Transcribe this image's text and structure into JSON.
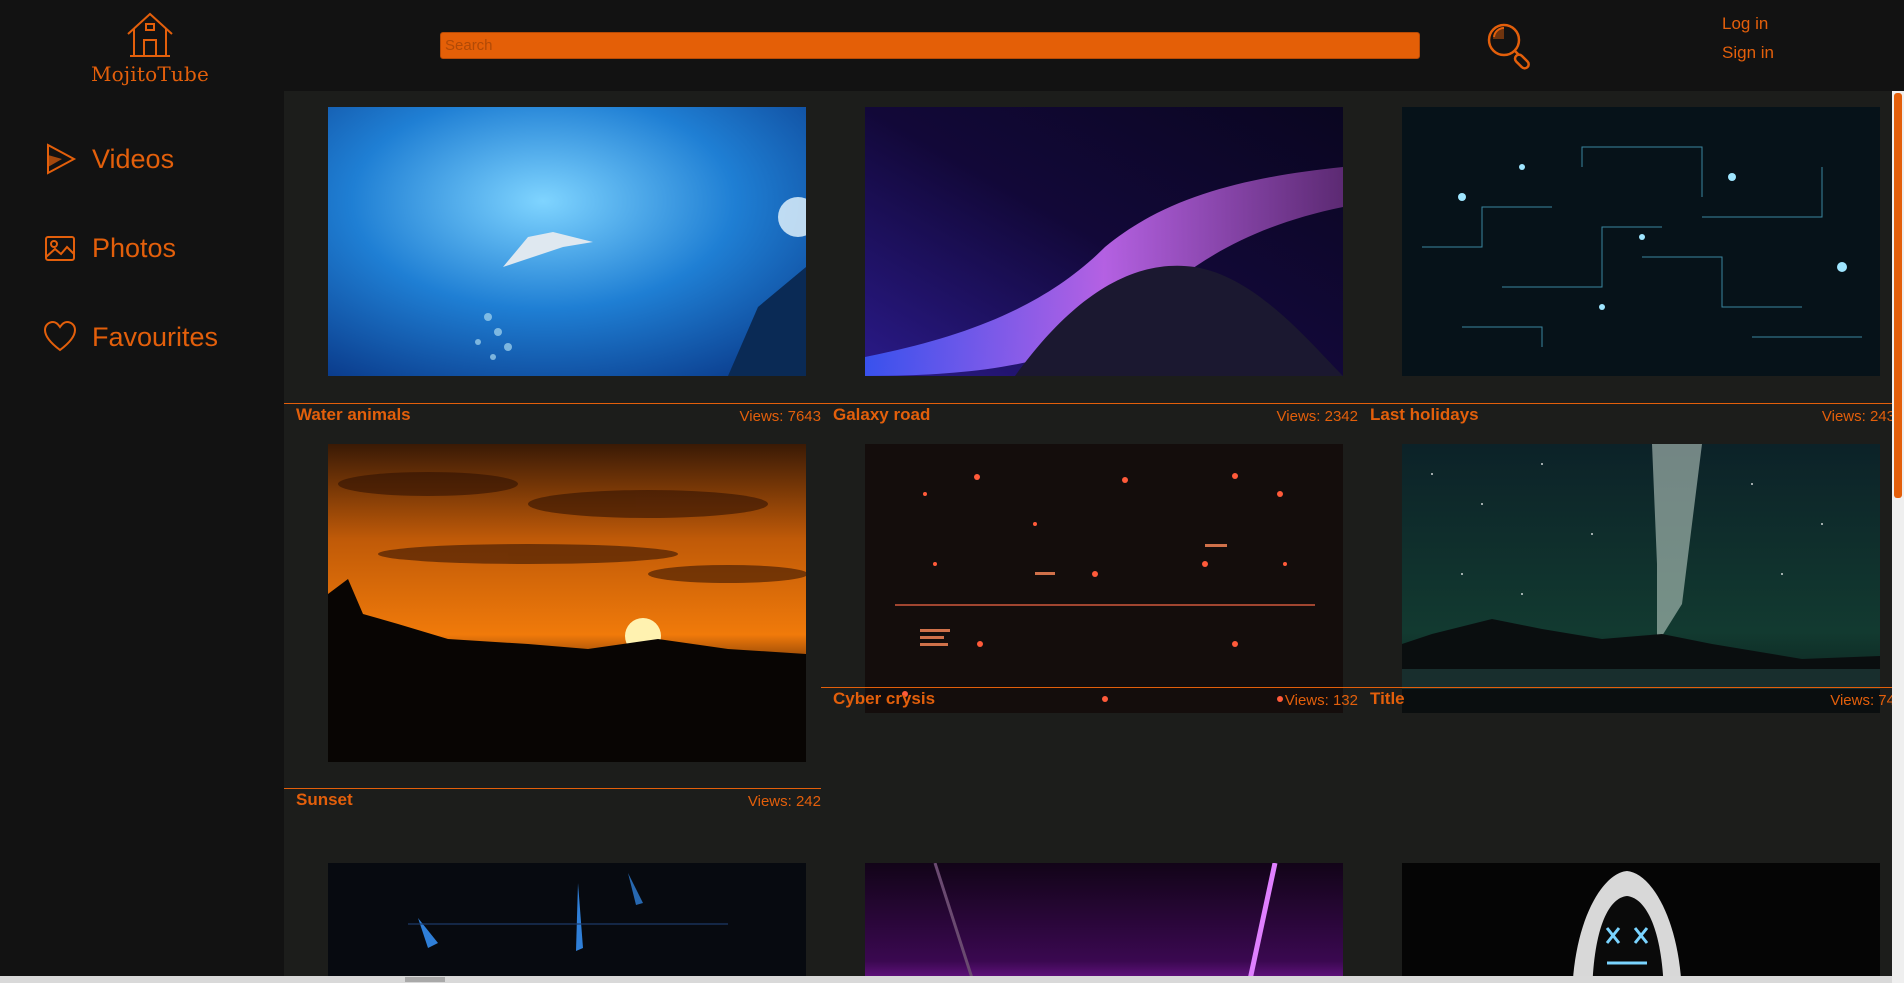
{
  "app": {
    "logo_text": "MojitoTube"
  },
  "header": {
    "search": {
      "placeholder": "Search",
      "value": ""
    },
    "auth": {
      "login_label": "Log in",
      "signin_label": "Sign in"
    }
  },
  "sidebar": {
    "items": [
      {
        "label": "Videos",
        "icon": "play-icon"
      },
      {
        "label": "Photos",
        "icon": "image-icon"
      },
      {
        "label": "Favourites",
        "icon": "heart-icon"
      }
    ]
  },
  "videos": [
    {
      "title": "Water animals",
      "views": "Views: 7643",
      "thumbnail": "underwater manta ray"
    },
    {
      "title": "Galaxy road",
      "views": "Views: 2342",
      "thumbnail": "purple particle wave"
    },
    {
      "title": "Last holidays",
      "views": "Views: 243",
      "thumbnail": "cyan digital circuit"
    },
    {
      "title": "Sunset",
      "views": "Views: 242",
      "thumbnail": "orange sunset over forest"
    },
    {
      "title": "Cyber crysis",
      "views": "Views: 132",
      "thumbnail": "red glowing dots"
    },
    {
      "title": "Title",
      "views": "Views: 74",
      "thumbnail": "milky way over lake"
    },
    {
      "title": "",
      "views": "",
      "thumbnail": "blue abstract shapes"
    },
    {
      "title": "",
      "views": "",
      "thumbnail": "purple neon lines"
    },
    {
      "title": "",
      "views": "",
      "thumbnail": "neon mask in hoodie"
    }
  ],
  "colors": {
    "accent": "#e35f0b",
    "search_bg": "#e45f07",
    "header_bg": "#121212",
    "content_bg": "#1c1d1b"
  }
}
